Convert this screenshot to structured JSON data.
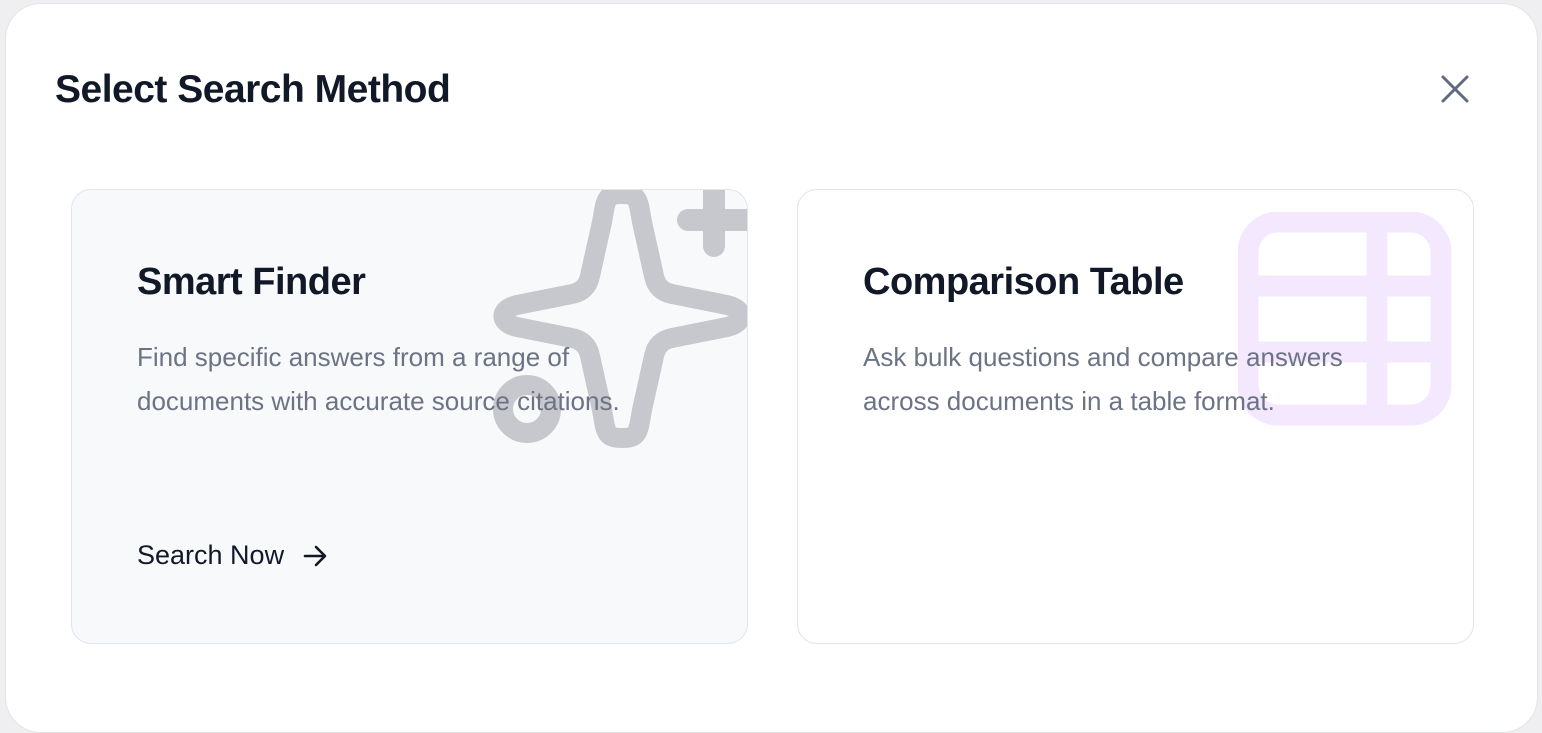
{
  "modal": {
    "title": "Select Search Method",
    "close_icon": "close-icon"
  },
  "cards": [
    {
      "title": "Smart Finder",
      "description": "Find specific answers from a range of documents with accurate source citations.",
      "cta_label": "Search Now",
      "cta_icon": "arrow-right-icon",
      "background_icon": "sparkles-icon",
      "icon_color": "#c7c8cd",
      "selected": true
    },
    {
      "title": "Comparison Table",
      "description": "Ask bulk questions and compare answers across documents in a table format.",
      "background_icon": "table-icon",
      "icon_color": "#f3e8fd",
      "selected": false
    }
  ],
  "colors": {
    "title": "#111827",
    "description": "#6b7384",
    "card_selected_bg": "#f8f9fb",
    "card_border": "#e2e4ea"
  }
}
